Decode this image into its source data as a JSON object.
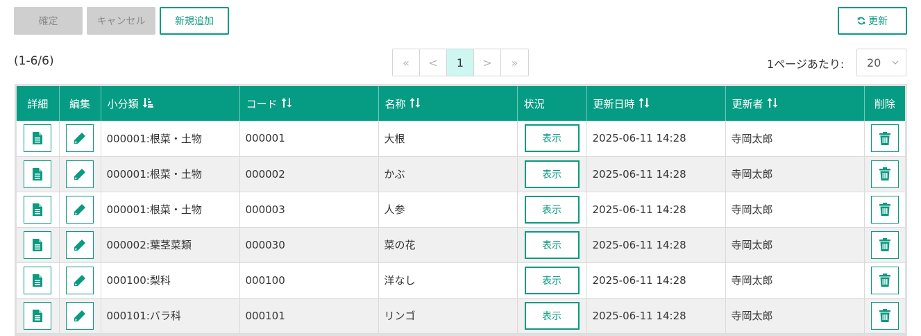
{
  "toolbar": {
    "confirm_label": "確定",
    "cancel_label": "キャンセル",
    "add_label": "新規追加",
    "refresh_label": "更新"
  },
  "pagination": {
    "count_text": "(1-6/6)",
    "first": "«",
    "prev": "<",
    "current": "1",
    "next": ">",
    "last": "»",
    "per_page_label": "1ページあたり:",
    "per_page_value": "20"
  },
  "table": {
    "headers": {
      "detail": "詳細",
      "edit": "編集",
      "subcategory": "小分類",
      "code": "コード",
      "name": "名称",
      "status": "状況",
      "updated_at": "更新日時",
      "updated_by": "更新者",
      "delete": "削除"
    },
    "rows": [
      {
        "subcategory": "000001:根菜・土物",
        "code": "000001",
        "name": "大根",
        "status": "表示",
        "updated_at": "2025-06-11 14:28",
        "updated_by": "寺岡太郎"
      },
      {
        "subcategory": "000001:根菜・土物",
        "code": "000002",
        "name": "かぶ",
        "status": "表示",
        "updated_at": "2025-06-11 14:28",
        "updated_by": "寺岡太郎"
      },
      {
        "subcategory": "000001:根菜・土物",
        "code": "000003",
        "name": "人参",
        "status": "表示",
        "updated_at": "2025-06-11 14:28",
        "updated_by": "寺岡太郎"
      },
      {
        "subcategory": "000002:葉茎菜類",
        "code": "000030",
        "name": "菜の花",
        "status": "表示",
        "updated_at": "2025-06-11 14:28",
        "updated_by": "寺岡太郎"
      },
      {
        "subcategory": "000100:梨科",
        "code": "000100",
        "name": "洋なし",
        "status": "表示",
        "updated_at": "2025-06-11 14:28",
        "updated_by": "寺岡太郎"
      },
      {
        "subcategory": "000101:バラ科",
        "code": "000101",
        "name": "リンゴ",
        "status": "表示",
        "updated_at": "2025-06-11 14:28",
        "updated_by": "寺岡太郎"
      }
    ]
  },
  "colors": {
    "accent": "#069c84",
    "accent_border": "#0b9a82",
    "disabled_button": "#cfcfcf",
    "current_page_bg": "#cff7f2",
    "row_stripe": "#f0f0f0"
  },
  "icons": {
    "detail": "document-icon",
    "edit": "pencil-icon",
    "delete": "trash-icon",
    "refresh": "refresh-icon",
    "sort_active": "sort-ascending-icon",
    "sort": "sort-both-icon",
    "select": "chevron-down-icon"
  }
}
